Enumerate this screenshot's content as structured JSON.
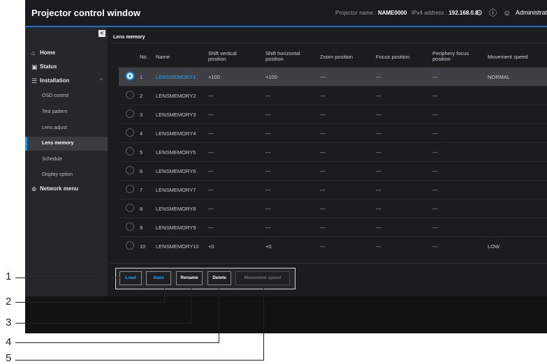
{
  "header": {
    "app_title": "Projector control window",
    "projector_name_label": "Projector name :",
    "projector_name": "NAME0000",
    "ipv4_label": "IPv4 address :",
    "ipv4": "192.168.0.8",
    "user": "Administrator"
  },
  "sidebar": {
    "home": "Home",
    "status": "Status",
    "installation": "Installation",
    "sub_items": [
      "OSD control",
      "Test pattern",
      "Lens adjust",
      "Lens memory",
      "Schedule",
      "Display option"
    ],
    "network": "Network menu"
  },
  "main": {
    "section_title": "Lens memory",
    "columns": [
      "No.",
      "Name",
      "Shift vertical position",
      "Shift horizontal position",
      "Zoom position",
      "Focus position",
      "Periphery focus position",
      "Movement speed"
    ],
    "rows": [
      {
        "no": "1",
        "name": "LENSMEMORY1",
        "sv": "+100",
        "sh": "+100",
        "zoom": "---",
        "focus": "---",
        "periph": "---",
        "speed": "NORMAL"
      },
      {
        "no": "2",
        "name": "LENSMEMORY2",
        "sv": "---",
        "sh": "---",
        "zoom": "---",
        "focus": "---",
        "periph": "---",
        "speed": ""
      },
      {
        "no": "3",
        "name": "LENSMEMORY3",
        "sv": "---",
        "sh": "---",
        "zoom": "---",
        "focus": "---",
        "periph": "---",
        "speed": ""
      },
      {
        "no": "4",
        "name": "LENSMEMORY4",
        "sv": "---",
        "sh": "---",
        "zoom": "---",
        "focus": "---",
        "periph": "---",
        "speed": ""
      },
      {
        "no": "5",
        "name": "LENSMEMORY5",
        "sv": "---",
        "sh": "---",
        "zoom": "---",
        "focus": "---",
        "periph": "---",
        "speed": ""
      },
      {
        "no": "6",
        "name": "LENSMEMORY6",
        "sv": "---",
        "sh": "---",
        "zoom": "---",
        "focus": "---",
        "periph": "---",
        "speed": ""
      },
      {
        "no": "7",
        "name": "LENSMEMORY7",
        "sv": "---",
        "sh": "---",
        "zoom": "---",
        "focus": "---",
        "periph": "---",
        "speed": ""
      },
      {
        "no": "8",
        "name": "LENSMEMORY8",
        "sv": "---",
        "sh": "---",
        "zoom": "---",
        "focus": "---",
        "periph": "---",
        "speed": ""
      },
      {
        "no": "9",
        "name": "LENSMEMORY9",
        "sv": "---",
        "sh": "---",
        "zoom": "---",
        "focus": "---",
        "periph": "---",
        "speed": ""
      },
      {
        "no": "10",
        "name": "LENSMEMORY10",
        "sv": "+0",
        "sh": "+0",
        "zoom": "---",
        "focus": "---",
        "periph": "---",
        "speed": "LOW"
      }
    ],
    "selected_row": 1
  },
  "buttons": {
    "load": "Load",
    "save": "Save",
    "rename": "Rename",
    "delete": "Delete",
    "movement_speed": "Movement speed"
  },
  "callouts": [
    "1",
    "2",
    "3",
    "4",
    "5"
  ],
  "colors": {
    "accent": "#2aa0f0",
    "header_bar": "#1f6fd0",
    "background": "#121212"
  }
}
